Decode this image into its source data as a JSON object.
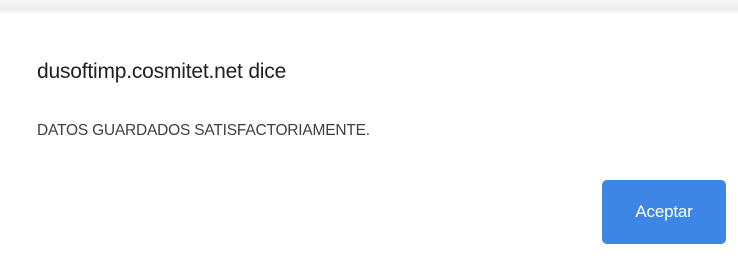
{
  "dialog": {
    "title": "dusoftimp.cosmitet.net dice",
    "message": "DATOS GUARDADOS SATISFACTORIAMENTE.",
    "accept_label": "Aceptar"
  },
  "colors": {
    "accent": "#3d86e6",
    "title_text": "#202124",
    "message_text": "#3c4043"
  }
}
